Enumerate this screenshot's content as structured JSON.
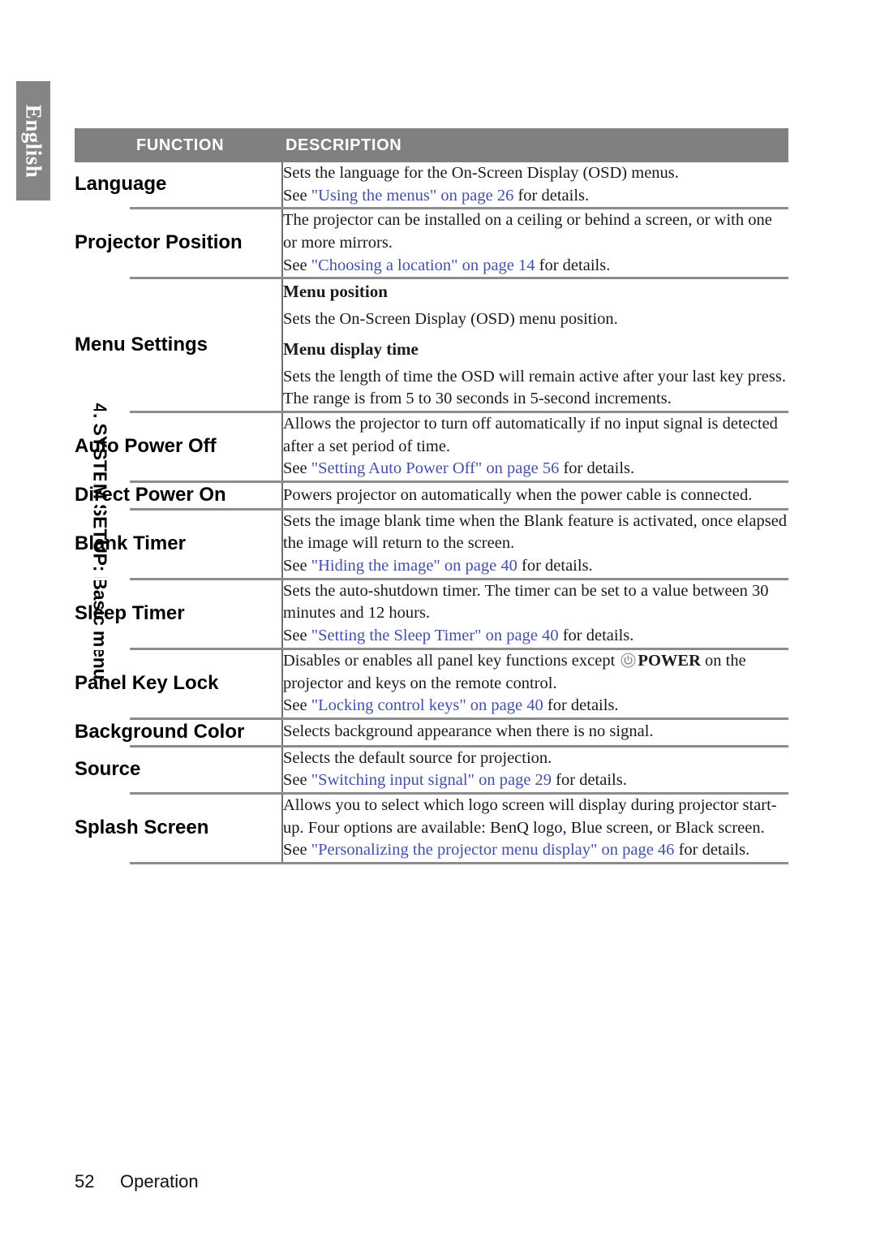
{
  "sidebar": {
    "language_tab": "English",
    "chapter_title": "4. SYSTEM SETUP: Basic menu"
  },
  "table": {
    "headers": {
      "function": "FUNCTION",
      "description": "DESCRIPTION"
    },
    "accent_gray": "#808080",
    "link_color": "#4450a8",
    "rows": [
      {
        "function": "Language",
        "lines": [
          {
            "text": "Sets the language for the On-Screen Display (OSD) menus."
          },
          {
            "pre": "See ",
            "link": "\"Using the menus\" on page 26",
            "post": " for details."
          }
        ]
      },
      {
        "function": "Projector Position",
        "lines": [
          {
            "text": "The projector can be installed on a ceiling or behind a screen, or with one or more mirrors."
          },
          {
            "pre": "See ",
            "link": "\"Choosing a location\" on page 14",
            "post": " for details."
          }
        ]
      },
      {
        "function": "Menu Settings",
        "sub1": "Menu position",
        "line1": "Sets the On-Screen Display (OSD) menu position.",
        "sub2": "Menu display time",
        "line2": "Sets the length of time the OSD will remain active after your last key press. The range is from 5 to 30 seconds in 5-second increments."
      },
      {
        "function": "Auto Power Off",
        "lines": [
          {
            "text": "Allows the projector to turn off automatically if no input signal is detected after a set period of time."
          },
          {
            "pre": "See ",
            "link": "\"Setting Auto Power Off\" on page 56",
            "post": " for details."
          }
        ]
      },
      {
        "function": "Direct Power On",
        "lines": [
          {
            "text": "Powers projector on automatically when the power cable is connected."
          }
        ]
      },
      {
        "function": "Blank Timer",
        "lines": [
          {
            "text": "Sets the image blank time when the Blank feature is activated, once elapsed the image will return to the screen."
          },
          {
            "pre": "See ",
            "link": "\"Hiding the image\" on page 40",
            "post": " for details."
          }
        ]
      },
      {
        "function": "Sleep Timer",
        "lines": [
          {
            "text": "Sets the auto-shutdown timer. The timer can be set to a value between 30 minutes and 12 hours."
          },
          {
            "pre": "See ",
            "link": "\"Setting the Sleep Timer\" on page 40",
            "post": " for details."
          }
        ]
      },
      {
        "function": "Panel Key Lock",
        "icon": "power-icon",
        "pre_icon": "Disables or enables all panel key functions except ",
        "power_label": "POWER",
        "post_icon": " on the projector and keys on the remote control.",
        "lines": [
          {
            "pre": "See ",
            "link": "\"Locking control keys\" on page 40",
            "post": " for details."
          }
        ]
      },
      {
        "function": "Background Color",
        "lines": [
          {
            "text": "Selects background appearance when there is no signal."
          }
        ]
      },
      {
        "function": "Source",
        "lines": [
          {
            "text": "Selects the default source for projection."
          },
          {
            "pre": "See ",
            "link": "\"Switching input signal\" on page 29",
            "post": " for details."
          }
        ]
      },
      {
        "function": "Splash Screen",
        "lines": [
          {
            "text": "Allows you to select which logo screen will display during projector start-up. Four options are available: BenQ logo, Blue screen, or Black screen."
          },
          {
            "pre": "See ",
            "link": "\"Personalizing the projector menu display\" on page 46",
            "post": " for details."
          }
        ]
      }
    ]
  },
  "footer": {
    "page_number": "52",
    "section": "Operation"
  }
}
